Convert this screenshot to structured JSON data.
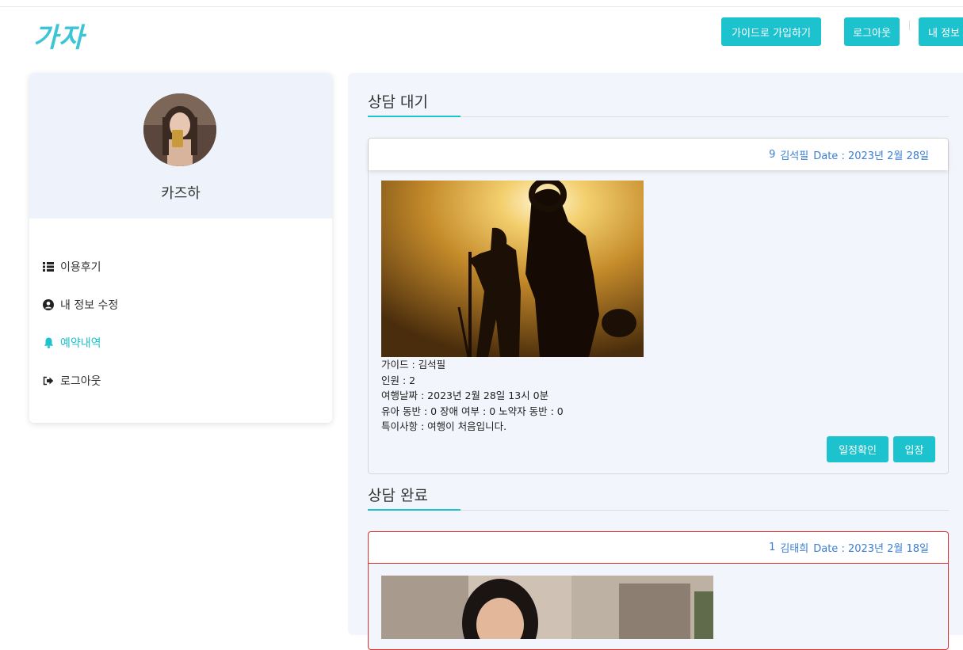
{
  "header": {
    "logo_text": "가자",
    "btn_guide_signup": "가이드로 가입하기",
    "btn_logout": "로그아웃",
    "btn_my_info": "내 정보"
  },
  "sidebar": {
    "profile_name": "카즈하",
    "items": [
      {
        "label": "이용후기",
        "icon": "list-icon"
      },
      {
        "label": "내 정보 수정",
        "icon": "user-circle-icon"
      },
      {
        "label": "예약내역",
        "icon": "bell-icon",
        "active": true
      },
      {
        "label": "로그아웃",
        "icon": "sign-out-icon"
      }
    ]
  },
  "sections": {
    "waiting_title": "상담 대기",
    "done_title": "상담 완료"
  },
  "waiting_card": {
    "number": "9",
    "guide": "김석필",
    "date": "Date : 2023년 2월 28일",
    "info": [
      "가이드 : 김석필",
      "인원 : 2",
      "여행날짜 : 2023년 2월 28일 13시 0분",
      "유아 동반 : 0 장애 여부 : 0 노약자 동반 : 0",
      "특이사항 : 여행이 처음입니다."
    ],
    "btn_schedule": "일정확인",
    "btn_enter": "입장"
  },
  "done_card": {
    "number": "1",
    "guide": "김태희",
    "date": "Date : 2023년 2월 18일"
  },
  "colors": {
    "accent": "#1cc3ce",
    "link_blue": "#3a7fd5",
    "done_border": "#e03131"
  }
}
